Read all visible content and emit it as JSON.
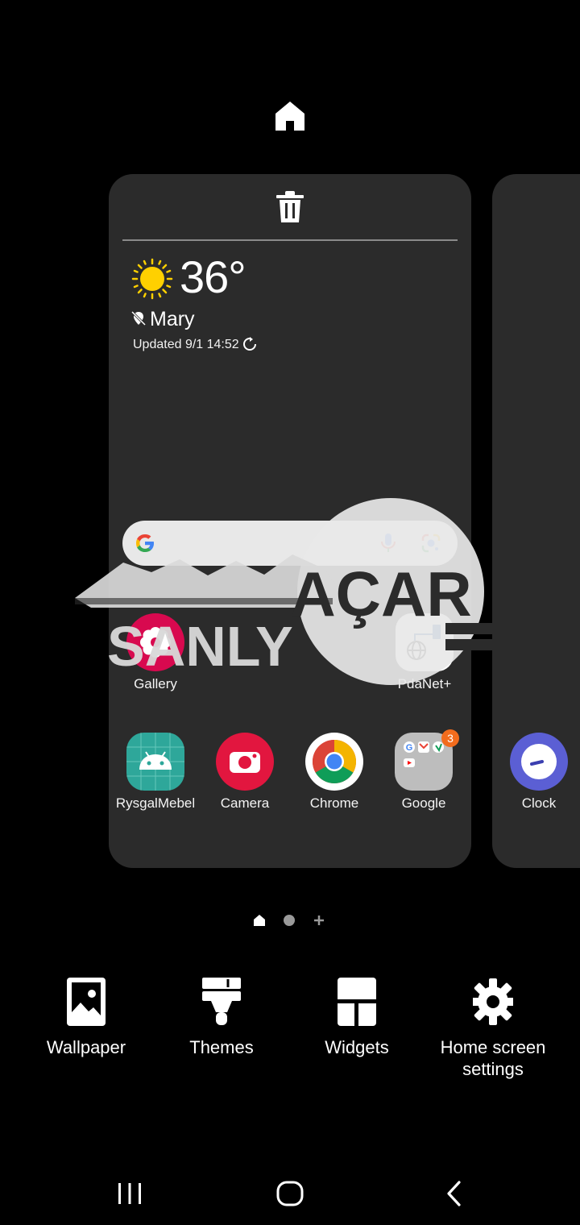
{
  "weather": {
    "temperature": "36°",
    "location": "Mary",
    "updated": "Updated 9/1 14:52"
  },
  "apps_row1": [
    {
      "label": "Gallery",
      "color": "#d8094f"
    },
    {
      "label": "PdaNet+",
      "color": "#ffffff"
    }
  ],
  "apps_row2": [
    {
      "label": "RysgalMebel",
      "color": "#2ea79a"
    },
    {
      "label": "Camera",
      "color": "#e2163f"
    },
    {
      "label": "Chrome",
      "color": "#ffffff"
    },
    {
      "label": "Google",
      "color": "#bdbdbd",
      "badge": "3"
    }
  ],
  "next_page_app": {
    "label": "Clock",
    "color": "#5b5fd4"
  },
  "watermark": {
    "text1": "AÇAR",
    "text2": "SANLY"
  },
  "options": {
    "wallpaper": "Wallpaper",
    "themes": "Themes",
    "widgets": "Widgets",
    "home_settings_line1": "Home screen",
    "home_settings_line2": "settings"
  },
  "icons": [
    "home-icon",
    "trash-icon",
    "sun-icon",
    "location-off-icon",
    "refresh-icon",
    "google-logo-icon",
    "mic-icon",
    "lens-icon",
    "wallpaper-icon",
    "themes-icon",
    "widgets-icon",
    "gear-icon",
    "recent-apps-icon",
    "nav-home-icon",
    "back-icon"
  ]
}
